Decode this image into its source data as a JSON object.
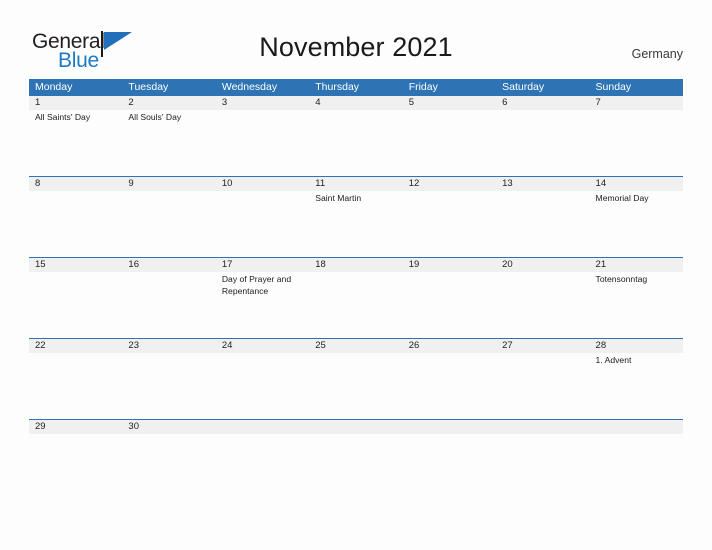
{
  "brand": {
    "name_part1": "General",
    "name_part2": "Blue",
    "flag_icon": "blue-flag-icon",
    "color_dark": "#231f20",
    "color_blue": "#1f7ac4"
  },
  "header": {
    "title": "November 2021",
    "country": "Germany"
  },
  "theme": {
    "header_blue": "#2e74b5",
    "date_band_gray": "#f0f0f0",
    "page_background": "#fdfdfd",
    "text_dark": "#1a1a1a"
  },
  "calendar": {
    "month": "November",
    "year": "2021",
    "weekday_headers": [
      "Monday",
      "Tuesday",
      "Wednesday",
      "Thursday",
      "Friday",
      "Saturday",
      "Sunday"
    ],
    "weeks": [
      {
        "days": [
          {
            "date": "1",
            "event": "All Saints' Day"
          },
          {
            "date": "2",
            "event": "All Souls' Day"
          },
          {
            "date": "3",
            "event": ""
          },
          {
            "date": "4",
            "event": ""
          },
          {
            "date": "5",
            "event": ""
          },
          {
            "date": "6",
            "event": ""
          },
          {
            "date": "7",
            "event": ""
          }
        ]
      },
      {
        "days": [
          {
            "date": "8",
            "event": ""
          },
          {
            "date": "9",
            "event": ""
          },
          {
            "date": "10",
            "event": ""
          },
          {
            "date": "11",
            "event": "Saint Martin"
          },
          {
            "date": "12",
            "event": ""
          },
          {
            "date": "13",
            "event": ""
          },
          {
            "date": "14",
            "event": "Memorial Day"
          }
        ]
      },
      {
        "days": [
          {
            "date": "15",
            "event": ""
          },
          {
            "date": "16",
            "event": ""
          },
          {
            "date": "17",
            "event": "Day of Prayer and Repentance"
          },
          {
            "date": "18",
            "event": ""
          },
          {
            "date": "19",
            "event": ""
          },
          {
            "date": "20",
            "event": ""
          },
          {
            "date": "21",
            "event": "Totensonntag"
          }
        ]
      },
      {
        "days": [
          {
            "date": "22",
            "event": ""
          },
          {
            "date": "23",
            "event": ""
          },
          {
            "date": "24",
            "event": ""
          },
          {
            "date": "25",
            "event": ""
          },
          {
            "date": "26",
            "event": ""
          },
          {
            "date": "27",
            "event": ""
          },
          {
            "date": "28",
            "event": "1. Advent"
          }
        ]
      },
      {
        "short": true,
        "days": [
          {
            "date": "29",
            "event": ""
          },
          {
            "date": "30",
            "event": ""
          },
          {
            "date": "",
            "event": ""
          },
          {
            "date": "",
            "event": ""
          },
          {
            "date": "",
            "event": ""
          },
          {
            "date": "",
            "event": ""
          },
          {
            "date": "",
            "event": ""
          }
        ]
      }
    ]
  }
}
